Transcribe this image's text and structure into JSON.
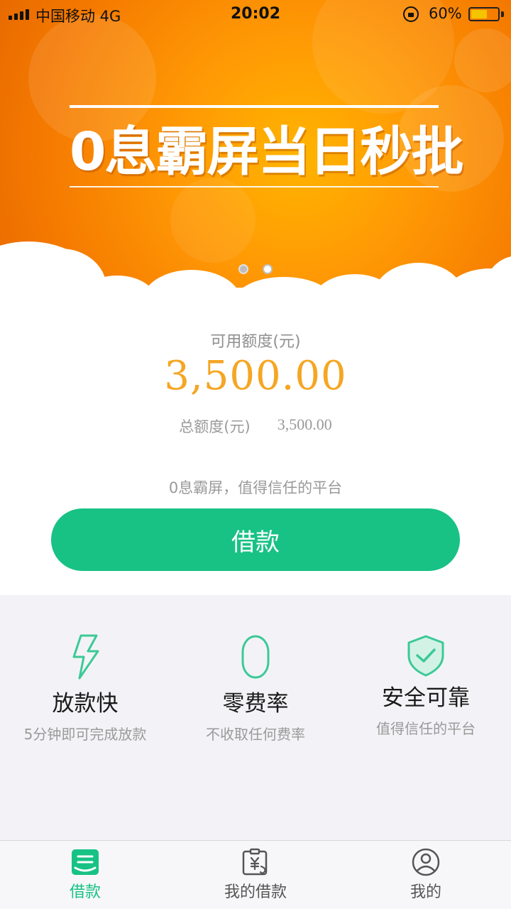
{
  "status_bar": {
    "carrier": "中国移动   4G",
    "time": "20:02",
    "battery_percent": "60%",
    "battery_level": 0.6
  },
  "banner": {
    "slogan_left": "0息霸屏",
    "slogan_right": "当日秒批",
    "active_slide": 2,
    "slide_count": 2
  },
  "credit": {
    "available_label": "可用额度(元)",
    "available_amount": "3,500.00",
    "total_label": "总额度(元)",
    "total_amount": "3,500.00",
    "tagline": "0息霸屏，值得信任的平台",
    "borrow_button": "借款"
  },
  "features": [
    {
      "icon": "lightning-icon",
      "title": "放款快",
      "subtitle": "5分钟即可完成放款"
    },
    {
      "icon": "zero-icon",
      "title": "零费率",
      "subtitle": "不收取任何费率"
    },
    {
      "icon": "shield-check-icon",
      "title": "安全可靠",
      "subtitle": "值得信任的平台"
    }
  ],
  "tabs": [
    {
      "icon": "loan-icon",
      "label": "借款",
      "active": true
    },
    {
      "icon": "bill-icon",
      "label": "我的借款",
      "active": false
    },
    {
      "icon": "user-icon",
      "label": "我的",
      "active": false
    }
  ],
  "colors": {
    "accent_green": "#17c284",
    "amount_orange": "#f5a623",
    "banner_orange": "#ff9a05"
  }
}
